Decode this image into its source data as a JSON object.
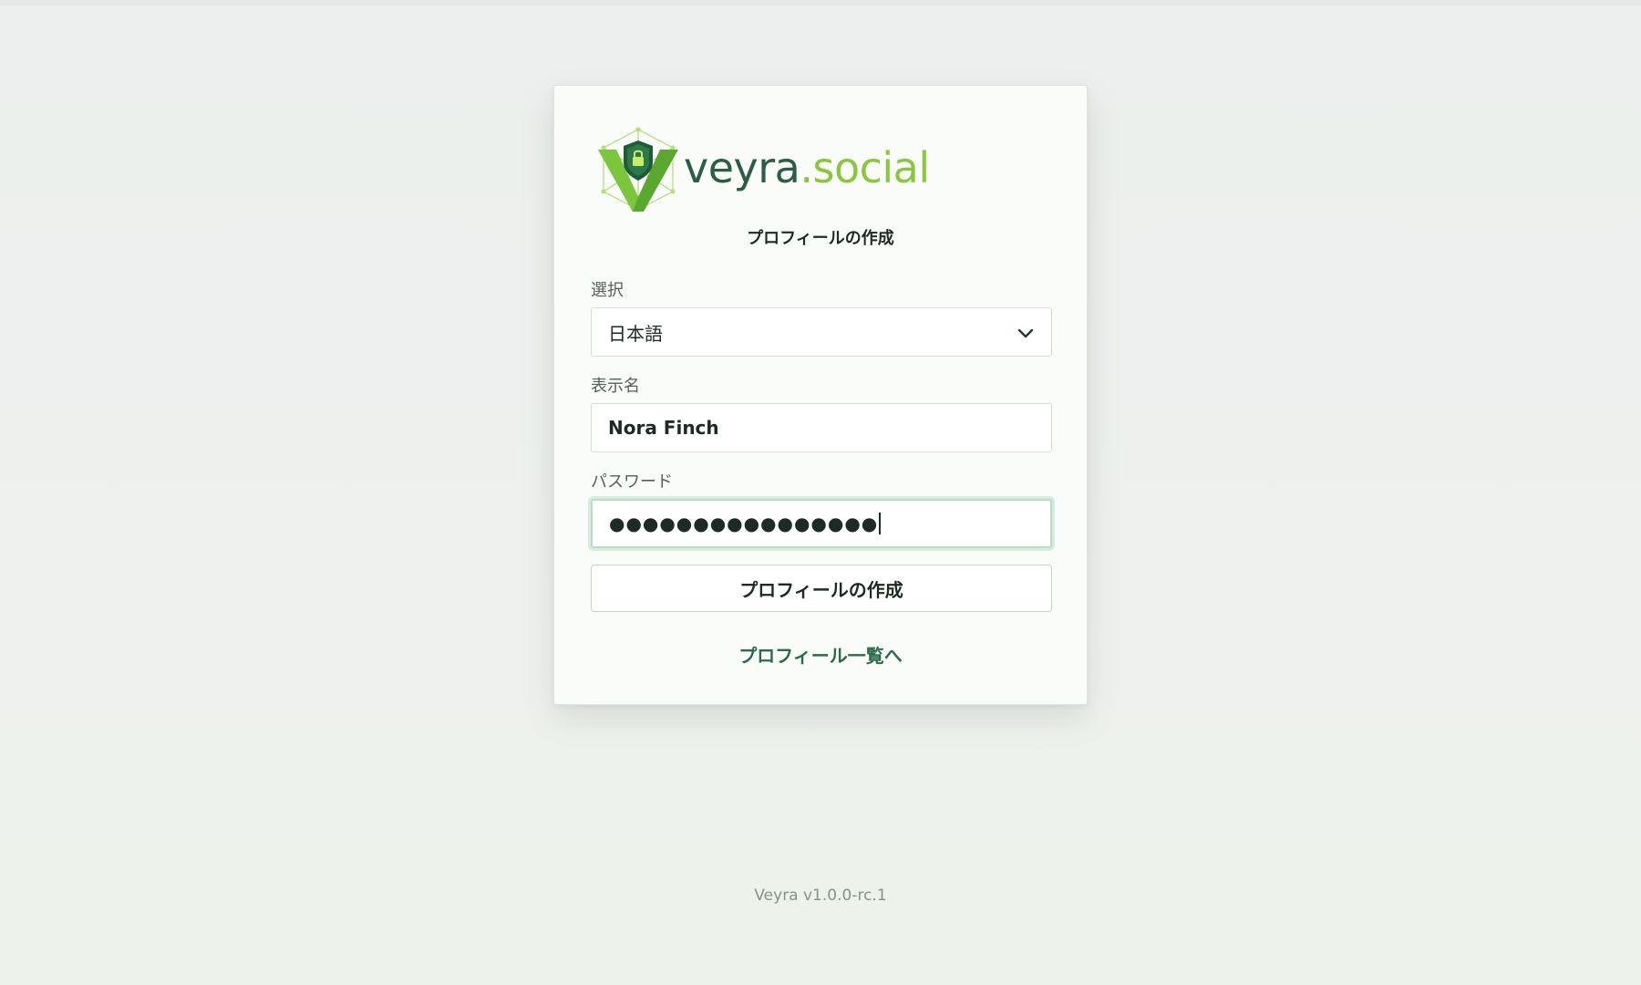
{
  "logo": {
    "brand": "veyra",
    "tld": ".social",
    "icon": "veyra-shield-logo-icon"
  },
  "form": {
    "title": "プロフィールの作成",
    "language": {
      "label": "選択",
      "value": "日本語"
    },
    "display_name": {
      "label": "表示名",
      "value": "Nora Finch"
    },
    "password": {
      "label": "パスワード",
      "masked_value": "●●●●●●●●●●●●●●●●"
    },
    "submit_label": "プロフィールの作成",
    "profile_list_link": "プロフィール一覧へ"
  },
  "footer": {
    "version": "Veyra v1.0.0-rc.1"
  },
  "colors": {
    "brand_dark": "#2c5e45",
    "brand_light": "#8cc63f",
    "link": "#2c6a4a",
    "focus_ring": "#b8dcc4"
  }
}
